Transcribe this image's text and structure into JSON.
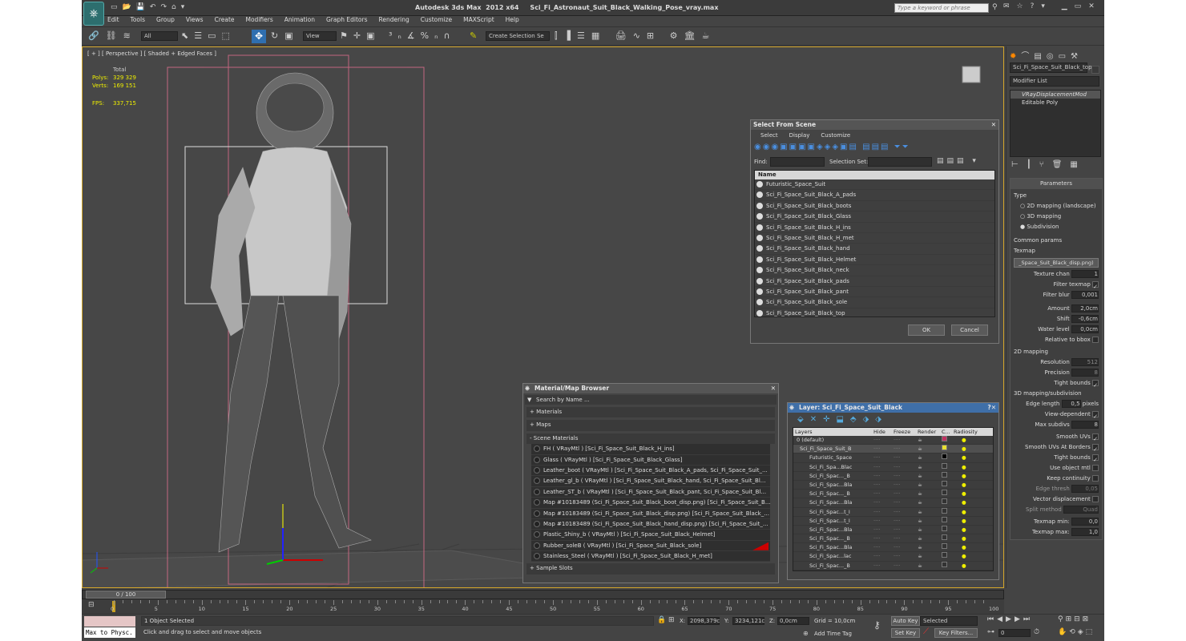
{
  "title": "Autodesk 3ds Max  2012 x64     Sci_Fi_Astronaut_Suit_Black_Walking_Pose_vray.max",
  "search_placeholder": "Type a keyword or phrase",
  "menu": [
    "Edit",
    "Tools",
    "Group",
    "Views",
    "Create",
    "Modifiers",
    "Animation",
    "Graph Editors",
    "Rendering",
    "Customize",
    "MAXScript",
    "Help"
  ],
  "toolbar": {
    "filter": "All",
    "refcoord": "View",
    "named_sel": "Create Selection Se"
  },
  "viewport": {
    "label": "[ + ] [ Perspective ] [ Shaded + Edged Faces ]",
    "stats_header": "Total",
    "polys_label": "Polys:",
    "polys": "329 329",
    "verts_label": "Verts:",
    "verts": "169 151",
    "fps_label": "FPS:",
    "fps": "337,715"
  },
  "select_from_scene": {
    "title": "Select From Scene",
    "tabs": [
      "Select",
      "Display",
      "Customize"
    ],
    "find_label": "Find:",
    "selset_label": "Selection Set:",
    "col_name": "Name",
    "items": [
      "Futuristic_Space_Suit",
      "Sci_Fi_Space_Suit_Black_A_pads",
      "Sci_Fi_Space_Suit_Black_boots",
      "Sci_Fi_Space_Suit_Black_Glass",
      "Sci_Fi_Space_Suit_Black_H_ins",
      "Sci_Fi_Space_Suit_Black_H_met",
      "Sci_Fi_Space_Suit_Black_hand",
      "Sci_Fi_Space_Suit_Black_Helmet",
      "Sci_Fi_Space_Suit_Black_neck",
      "Sci_Fi_Space_Suit_Black_pads",
      "Sci_Fi_Space_Suit_Black_pant",
      "Sci_Fi_Space_Suit_Black_sole",
      "Sci_Fi_Space_Suit_Black_top"
    ],
    "ok": "OK",
    "cancel": "Cancel"
  },
  "material_browser": {
    "title": "Material/Map Browser",
    "search": "Search by Name ...",
    "sections": [
      "+ Materials",
      "+ Maps",
      "- Scene Materials"
    ],
    "items": [
      "FH  ( VRayMtl ) [Sci_Fi_Space_Suit_Black_H_ins]",
      "Glass  ( VRayMtl ) [Sci_Fi_Space_Suit_Black_Glass]",
      "Leather_boot  ( VRayMtl ) [Sci_Fi_Space_Suit_Black_A_pads, Sci_Fi_Space_Suit_...",
      "Leather_gl_b  ( VRayMtl ) [Sci_Fi_Space_Suit_Black_hand, Sci_Fi_Space_Suit_Bl...",
      "Leather_ST_b  ( VRayMtl ) [Sci_Fi_Space_Suit_Black_pant, Sci_Fi_Space_Suit_Bl...",
      "Map #10183489 (Sci_Fi_Space_Suit_Black_boot_disp.png) [Sci_Fi_Space_Suit_B...",
      "Map #10183489 (Sci_Fi_Space_Suit_Black_disp.png) [Sci_Fi_Space_Suit_Black_...",
      "Map #10183489 (Sci_Fi_Space_Suit_Black_hand_disp.png) [Sci_Fi_Space_Suit_...",
      "Plastic_Shiny_b  ( VRayMtl ) [Sci_Fi_Space_Suit_Black_Helmet]",
      "Rubber_soleB  ( VRayMtl ) [Sci_Fi_Space_Suit_Black_sole]",
      "Stainless_Steel  ( VRayMtl ) [Sci_Fi_Space_Suit_Black_H_met]"
    ],
    "footer": "+ Sample Slots"
  },
  "layer_dialog": {
    "title": "Layer: Sci_Fi_Space_Suit_Black",
    "cols": [
      "Layers",
      "Hide",
      "Freeze",
      "Render",
      "C...",
      "Radiosity"
    ],
    "rows": [
      "0 (default)",
      "Sci_Fi_Space_Suit_B",
      "Futuristic_Space",
      "Sci_Fi_Spa...Blac",
      "Sci_Fi_Spac..._B",
      "Sci_Fi_Spac...Bla",
      "Sci_Fi_Spac..._B",
      "Sci_Fi_Spac...Bla",
      "Sci_Fi_Spac...t_I",
      "Sci_Fi_Spac...t_I",
      "Sci_Fi_Spac...Bla",
      "Sci_Fi_Spac..._B",
      "Sci_Fi_Spac...Bla",
      "Sci_Fi_Spac...lac",
      "Sci_Fi_Spac..._B",
      "Sci_Fi_Spac...lac"
    ]
  },
  "command_panel": {
    "object_name": "Sci_Fi_Space_Suit_Black_top",
    "modifier_list": "Modifier List",
    "stack": [
      "VRayDisplacementMod",
      "Editable Poly"
    ],
    "rollout": "Parameters",
    "type_label": "Type",
    "types": [
      "2D mapping (landscape)",
      "3D mapping",
      "Subdivision"
    ],
    "common": "Common params",
    "texmap_label": "Texmap",
    "texmap": "_Space_Suit_Black_disp.png)",
    "tex_chan_label": "Texture chan",
    "tex_chan": "1",
    "filter_texmap": "Filter texmap",
    "filter_blur_label": "Filter blur",
    "filter_blur": "0,001",
    "amount_label": "Amount",
    "amount": "2,0cm",
    "shift_label": "Shift",
    "shift": "-0,6cm",
    "water_label": "Water level",
    "water": "0,0cm",
    "relbbox": "Relative to bbox",
    "map2d": "2D mapping",
    "res_label": "Resolution",
    "res": "512",
    "prec_label": "Precision",
    "prec": "8",
    "tight1": "Tight bounds",
    "map3d": "3D mapping/subdivision",
    "edge_label": "Edge length",
    "edge": "0,5",
    "edge_unit": "pixels",
    "viewdep": "View-dependent",
    "maxsub_label": "Max subdivs",
    "maxsub": "8",
    "smooth": "Smooth UVs",
    "smoothb": "Smooth UVs At Borders",
    "tight2": "Tight bounds",
    "useobj": "Use object mtl",
    "keepcont": "Keep continuity",
    "edgethr_label": "Edge thresh",
    "edgethr": "0,05",
    "vecdisp": "Vector displacement",
    "split_label": "Split method",
    "split": "Quad",
    "texmin_label": "Texmap min:",
    "texmin": "0,0",
    "texmax_label": "Texmap max:",
    "texmax": "1,0"
  },
  "timeline": {
    "frame": "0 / 100",
    "ticks": [
      "0",
      "5",
      "10",
      "15",
      "20",
      "25",
      "30",
      "35",
      "40",
      "45",
      "50",
      "55",
      "60",
      "65",
      "70",
      "75",
      "80",
      "85",
      "90",
      "95",
      "100"
    ]
  },
  "status": {
    "maxscript": "Max to Physc.",
    "selected": "1 Object Selected",
    "prompt": "Click and drag to select and move objects",
    "x_label": "X:",
    "x": "2098,379c",
    "y_label": "Y:",
    "y": "3234,121c",
    "z_label": "Z:",
    "z": "0,0cm",
    "grid": "Grid = 10,0cm",
    "autokey": "Auto Key",
    "autokey_val": "Selected",
    "setkey": "Set Key",
    "keyfilters": "Key Filters...",
    "addtime": "Add Time Tag",
    "frame_field": "0"
  }
}
